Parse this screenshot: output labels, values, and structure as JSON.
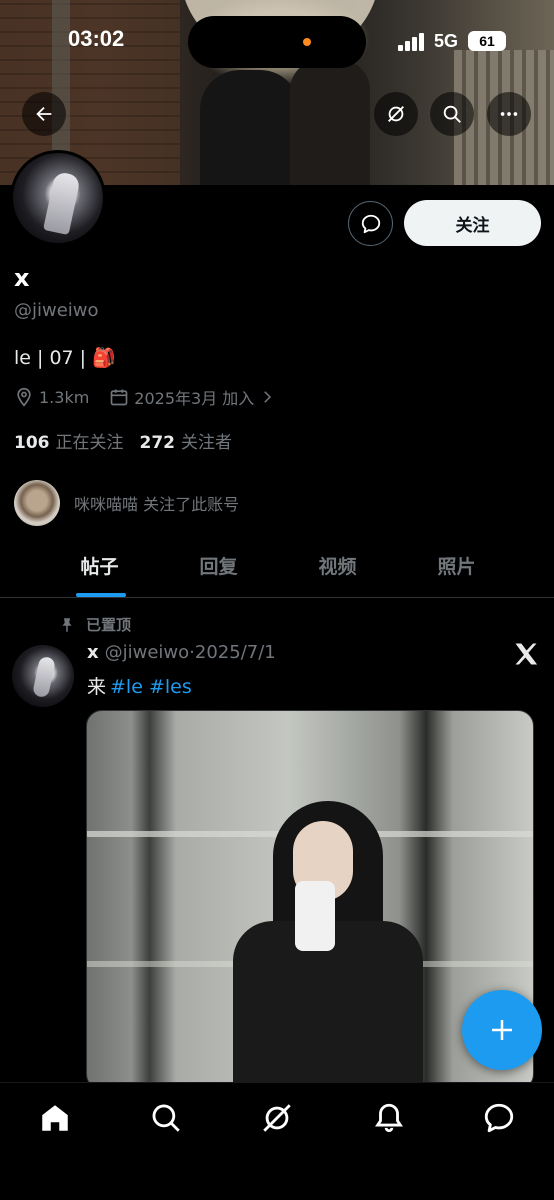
{
  "status_bar": {
    "time": "03:02",
    "network": "5G",
    "battery": "61"
  },
  "profile": {
    "name": "x",
    "handle": "@jiweiwo",
    "bio": "le | 07 | 🎒",
    "location": "1.3km",
    "joined": "2025年3月 加入",
    "following_count": "106",
    "following_label": "正在关注",
    "followers_count": "272",
    "followers_label": "关注者",
    "follow_button": "关注",
    "followed_by_text": "咪咪喵喵 关注了此账号"
  },
  "tabs": [
    {
      "label": "帖子",
      "active": true
    },
    {
      "label": "回复",
      "active": false
    },
    {
      "label": "视频",
      "active": false
    },
    {
      "label": "照片",
      "active": false
    }
  ],
  "pinned_post": {
    "pinned_label": "已置顶",
    "author_name": "x",
    "author_handle": "@jiweiwo",
    "separator": "·",
    "date": "2025/7/1",
    "text": "来",
    "hashtags": "#le #les"
  },
  "icons": {
    "back": "arrow-left-icon",
    "grok": "grok-icon",
    "search": "search-icon",
    "more": "more-icon",
    "message": "message-icon",
    "location": "location-icon",
    "calendar": "calendar-icon",
    "chevron": "chevron-right-icon",
    "pin": "pin-icon",
    "x_logo": "x-logo-icon",
    "compose": "plus-icon",
    "nav_home": "home-icon",
    "nav_search": "search-icon",
    "nav_grok": "grok-icon",
    "nav_notifications": "bell-icon",
    "nav_messages": "message-icon"
  },
  "colors": {
    "accent": "#1d9bf0",
    "background": "#000000",
    "secondary_text": "#71767b",
    "primary_text": "#e7e9ea"
  }
}
